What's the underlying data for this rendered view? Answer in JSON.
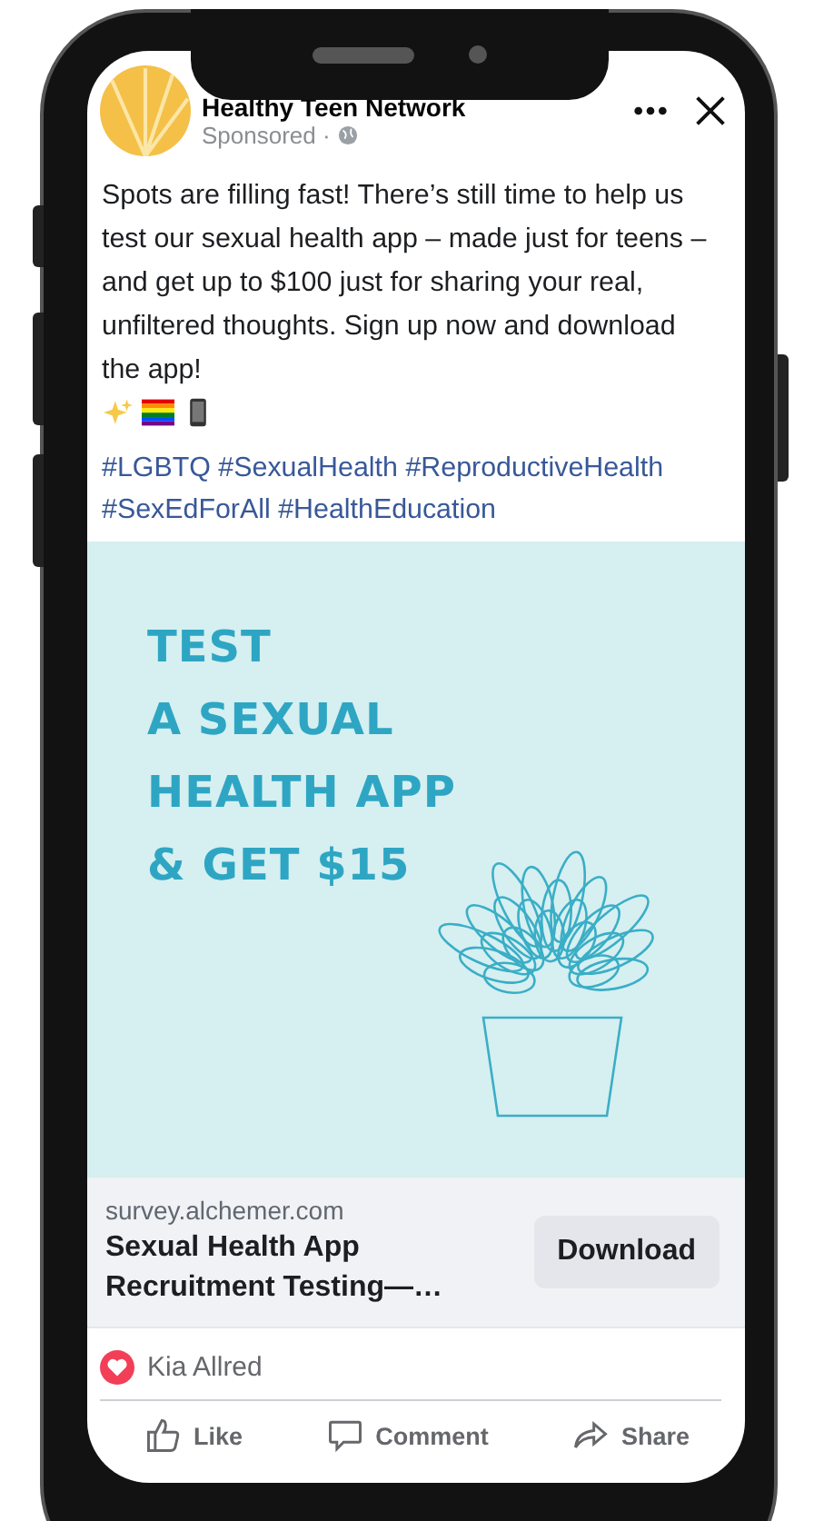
{
  "page": {
    "name": "Healthy Teen Network",
    "sponsored": "Sponsored ·"
  },
  "post": {
    "text": "Spots are filling fast! There’s still time to help us test our sexual health app – made just for teens – and get up to $100 just for sharing your real, unfiltered thoughts. Sign up now and download the app!",
    "hashtags": [
      "#LGBTQ",
      "#SexualHealth",
      "#ReproductiveHealth",
      "#SexEdForAll",
      "#HealthEducation"
    ]
  },
  "ad_image": {
    "headline_lines": [
      "TEST",
      "A SEXUAL",
      "HEALTH APP",
      "& GET $15"
    ]
  },
  "link": {
    "domain": "survey.alchemer.com",
    "title": "Sexual Health App Recruitment Testing—…",
    "button": "Download"
  },
  "reactions": {
    "names": "Kia Allred"
  },
  "actions": [
    {
      "kind": "like",
      "label": "Like"
    },
    {
      "kind": "comment",
      "label": "Comment"
    },
    {
      "kind": "share",
      "label": "Share"
    }
  ]
}
